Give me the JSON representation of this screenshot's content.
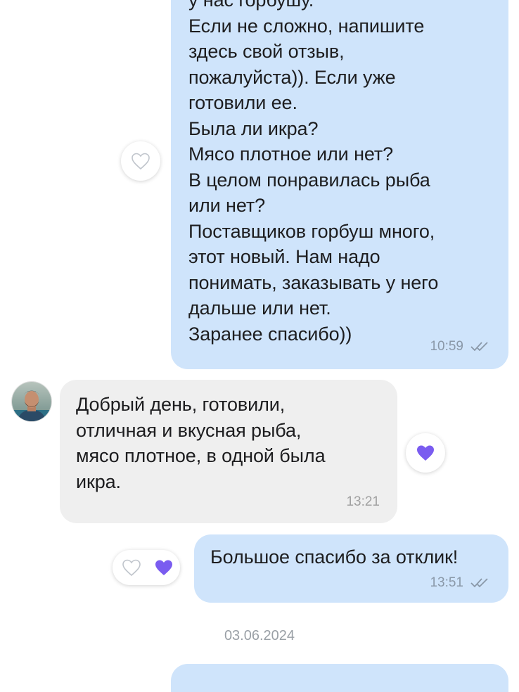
{
  "messages": [
    {
      "direction": "outgoing",
      "text": "у нас горбушу.\nЕсли не сложно, напишите\nздесь свой отзыв,\nпожалуйста)). Если уже\nготовили ее.\nБыла ли икра?\nМясо плотное или нет?\nВ целом понравилась рыба\nили нет?\nПоставщиков горбуш много,\nэтот новый. Нам надо\nпонимать, заказывать у него\nдальше или нет.\nЗаранее спасибо))",
      "time": "10:59",
      "status": "read-double-check",
      "reaction": "empty-heart"
    },
    {
      "direction": "incoming",
      "text": "Добрый день, готовили,\nотличная и вкусная рыба,\nмясо плотное, в одной была\nикра.",
      "time": "13:21",
      "reaction": "purple-heart"
    },
    {
      "direction": "outgoing",
      "text": "Большое спасибо за отклик!",
      "time": "13:51",
      "status": "read-double-check",
      "reactions": [
        "empty-heart",
        "purple-heart"
      ]
    }
  ],
  "date_separator": "03.06.2024",
  "colors": {
    "outgoing_bubble": "#cfe4fb",
    "incoming_bubble": "#efefef",
    "reaction_heart": "#7a5cf0",
    "time_outgoing": "#8a98a8",
    "time_incoming": "#a0a0a0"
  }
}
